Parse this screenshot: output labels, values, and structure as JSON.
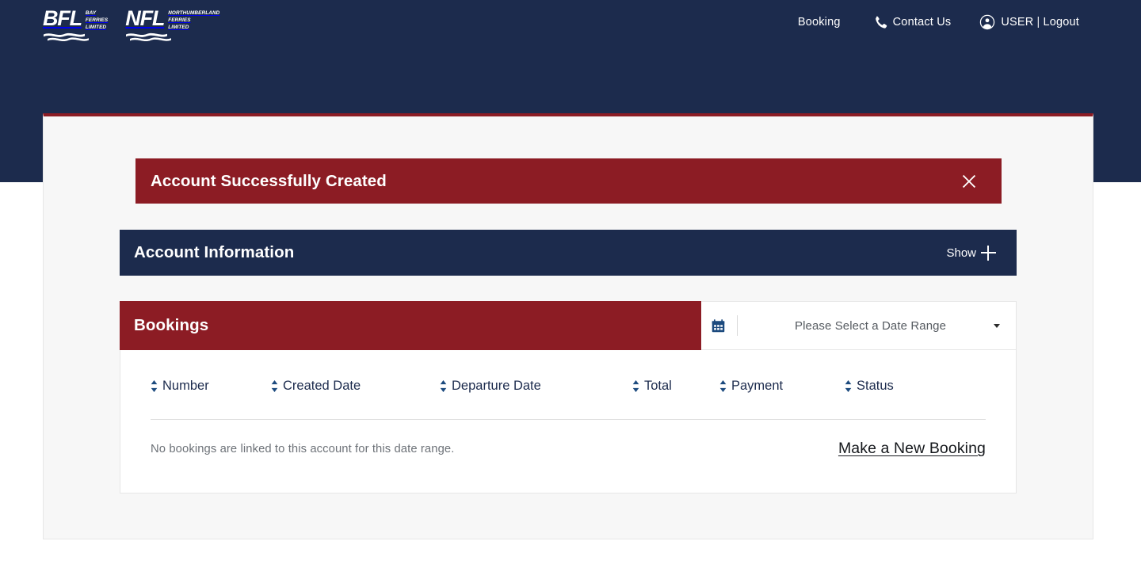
{
  "header": {
    "brands": [
      {
        "mark": "BFL",
        "words": [
          "BAY",
          "FERRIES",
          "LIMITED"
        ],
        "icon": "wave-logo-icon"
      },
      {
        "mark": "NFL",
        "words": [
          "NORTHUMBERLAND",
          "FERRIES",
          "LIMITED"
        ],
        "icon": "wave-logo-icon"
      }
    ],
    "nav": {
      "booking_label": "Booking",
      "contact_label": "Contact Us",
      "contact_icon": "phone-icon",
      "user_icon": "user-circle-icon",
      "user_label": "USER",
      "separator": "|",
      "logout_label": "Logout"
    }
  },
  "alert": {
    "message": "Account Successfully Created",
    "close_icon": "close-icon",
    "color": "#8c1c24"
  },
  "account_information": {
    "title": "Account Information",
    "toggle_label": "Show",
    "toggle_icon": "plus-icon",
    "color": "#1c2b4d"
  },
  "bookings": {
    "title": "Bookings",
    "color": "#8c1c24",
    "date_range": {
      "calendar_icon": "calendar-icon",
      "placeholder": "Please Select a Date Range",
      "value": "Please Select a Date Range",
      "caret_icon": "chevron-down-icon"
    },
    "columns": [
      {
        "label": "Number",
        "sort_icon": "sort-updown-icon"
      },
      {
        "label": "Created Date",
        "sort_icon": "sort-updown-icon"
      },
      {
        "label": "Departure Date",
        "sort_icon": "sort-updown-icon"
      },
      {
        "label": "Total",
        "sort_icon": "sort-updown-icon"
      },
      {
        "label": "Payment",
        "sort_icon": "sort-updown-icon"
      },
      {
        "label": "Status",
        "sort_icon": "sort-updown-icon"
      }
    ],
    "rows": [],
    "empty_message": "No bookings are linked to this account for this date range.",
    "new_booking_label": "Make a New Booking"
  }
}
